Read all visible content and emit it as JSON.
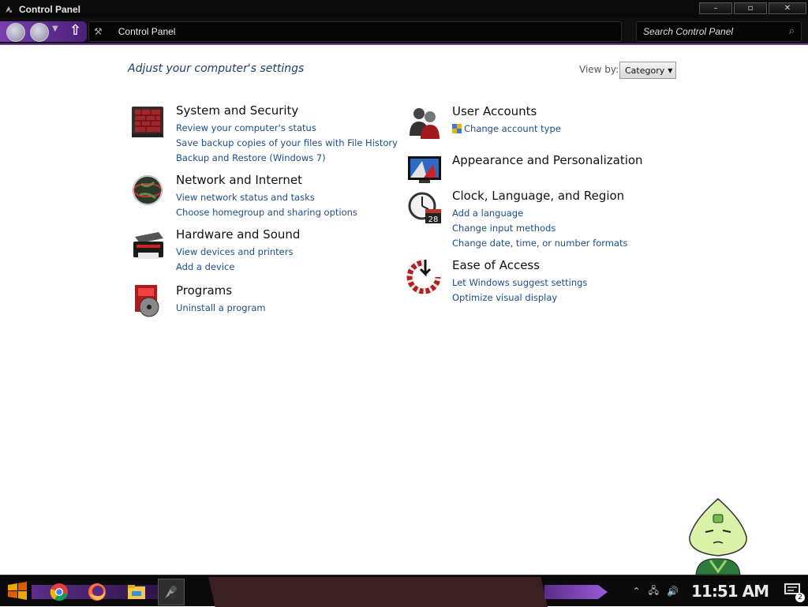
{
  "window": {
    "title": "Control Panel",
    "controls": {
      "minimize": "–",
      "maximize": "▫",
      "close": "✕"
    }
  },
  "address_bar": {
    "breadcrumb": "Control Panel",
    "search_placeholder": "Search Control Panel"
  },
  "content": {
    "heading": "Adjust your computer's settings",
    "view_by_label": "View by:",
    "view_by_value": "Category"
  },
  "categories": {
    "system": {
      "title": "System and Security",
      "links": [
        "Review your computer's status",
        "Save backup copies of your files with File History",
        "Backup and Restore (Windows 7)"
      ]
    },
    "network": {
      "title": "Network and Internet",
      "links": [
        "View network status and tasks",
        "Choose homegroup and sharing options"
      ]
    },
    "hardware": {
      "title": "Hardware and Sound",
      "links": [
        "View devices and printers",
        "Add a device"
      ]
    },
    "programs": {
      "title": "Programs",
      "links": [
        "Uninstall a program"
      ]
    },
    "users": {
      "title": "User Accounts",
      "links": [
        "Change account type"
      ]
    },
    "appearance": {
      "title": "Appearance and Personalization",
      "links": []
    },
    "clock": {
      "title": "Clock, Language, and Region",
      "links": [
        "Add a language",
        "Change input methods",
        "Change date, time, or number formats"
      ]
    },
    "ease": {
      "title": "Ease of Access",
      "links": [
        "Let Windows suggest settings",
        "Optimize visual display"
      ]
    }
  },
  "clock_icon_date": "28",
  "taskbar": {
    "apps": [
      "start-icon",
      "chrome-icon",
      "firefox-icon",
      "file-explorer-icon",
      "control-panel-icon"
    ],
    "time": "11:51 AM",
    "notification_count": "2"
  },
  "colors": {
    "link": "#1d4e86",
    "heading": "#1e3f66",
    "accent_purple": "#6a3d9a",
    "taskbar_bg": "#0a0a0a"
  }
}
